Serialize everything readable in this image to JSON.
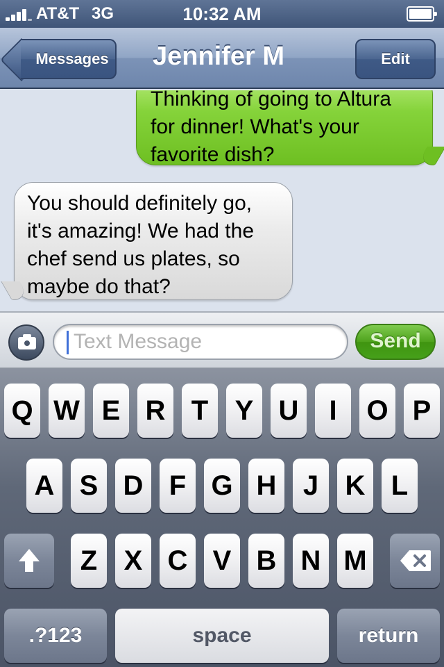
{
  "status_bar": {
    "carrier": "AT&T",
    "network": "3G",
    "time": "10:32 AM"
  },
  "nav": {
    "back_label": "Messages",
    "title": "Jennifer M",
    "edit_label": "Edit"
  },
  "messages": [
    {
      "direction": "outgoing",
      "lines": [
        "Thinking of going to Altura",
        "for dinner! What's your",
        "favorite dish?"
      ]
    },
    {
      "direction": "incoming",
      "lines": [
        "You should definitely go,",
        "it's amazing! We had the",
        "chef send us plates, so",
        "maybe do that?"
      ]
    }
  ],
  "composer": {
    "placeholder": "Text Message",
    "value": "",
    "send_label": "Send"
  },
  "keyboard": {
    "row1": [
      "Q",
      "W",
      "E",
      "R",
      "T",
      "Y",
      "U",
      "I",
      "O",
      "P"
    ],
    "row2": [
      "A",
      "S",
      "D",
      "F",
      "G",
      "H",
      "J",
      "K",
      "L"
    ],
    "row3": [
      "Z",
      "X",
      "C",
      "V",
      "B",
      "N",
      "M"
    ],
    "numbers_label": ".?123",
    "space_label": "space",
    "return_label": "return",
    "shift_icon": "shift-arrow-icon",
    "delete_icon": "backspace-icon"
  },
  "colors": {
    "outgoing_bubble": "#85d33a",
    "incoming_bubble": "#ebebeb",
    "send_button": "#4ea21c",
    "nav_bar": "#7c93b7"
  }
}
